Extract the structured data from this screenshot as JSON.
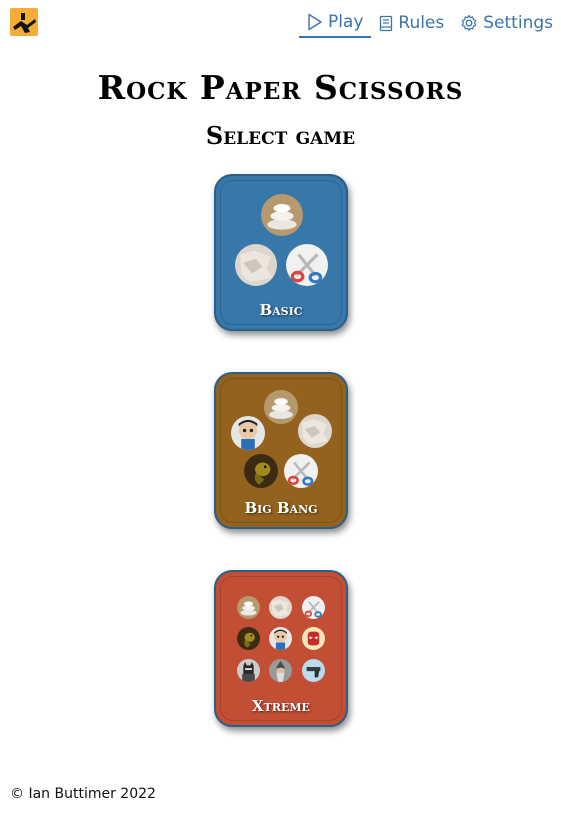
{
  "nav": {
    "items": [
      {
        "label": "Play",
        "icon": "play-icon",
        "active": true
      },
      {
        "label": "Rules",
        "icon": "book-icon",
        "active": false
      },
      {
        "label": "Settings",
        "icon": "gear-icon",
        "active": false
      }
    ]
  },
  "header": {
    "title": "Rock Paper Scissors",
    "subtitle": "Select game"
  },
  "games": [
    {
      "label": "Basic",
      "color": "#3777a9",
      "items": [
        "rock",
        "paper",
        "scissors"
      ]
    },
    {
      "label": "Big Bang",
      "color": "#93621e",
      "items": [
        "rock",
        "spock",
        "paper",
        "lizard",
        "scissors"
      ]
    },
    {
      "label": "Xtreme",
      "color": "#c24e34",
      "items": [
        "rock",
        "paper",
        "scissors",
        "lizard",
        "spock",
        "spider-man",
        "batman",
        "wizard",
        "gun"
      ]
    }
  ],
  "footer": {
    "copyright": "© Ian Buttimer 2022"
  },
  "colors": {
    "accent": "#3b74a8",
    "logo": "#f6ad38"
  }
}
